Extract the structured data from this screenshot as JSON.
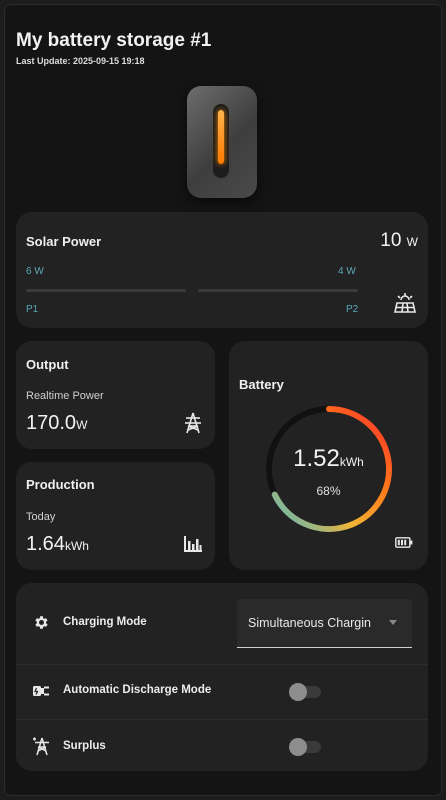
{
  "header": {
    "title": "My battery storage #1",
    "last_update": "Last Update: 2025-09-15 19:18"
  },
  "solar": {
    "title": "Solar Power",
    "total_value": "10",
    "total_unit": "W",
    "p1_value": "6 W",
    "p2_value": "4 W",
    "p1_label": "P1",
    "p2_label": "P2",
    "icon": "solar-panel-icon"
  },
  "output": {
    "title": "Output",
    "label": "Realtime Power",
    "value": "170.0",
    "unit": "W",
    "icon": "transmission-tower-icon"
  },
  "production": {
    "title": "Production",
    "label": "Today",
    "value": "1.64",
    "unit": "kWh",
    "icon": "bar-chart-icon"
  },
  "battery": {
    "title": "Battery",
    "value": "1.52",
    "unit": "kWh",
    "percent": "68%",
    "level": 0.68,
    "icon": "battery-icon"
  },
  "settings": {
    "charging_mode_label": "Charging Mode",
    "charging_mode_value": "Simultaneous Chargin",
    "auto_discharge_label": "Automatic Discharge Mode",
    "auto_discharge_on": false,
    "surplus_label": "Surplus",
    "surplus_on": false
  }
}
